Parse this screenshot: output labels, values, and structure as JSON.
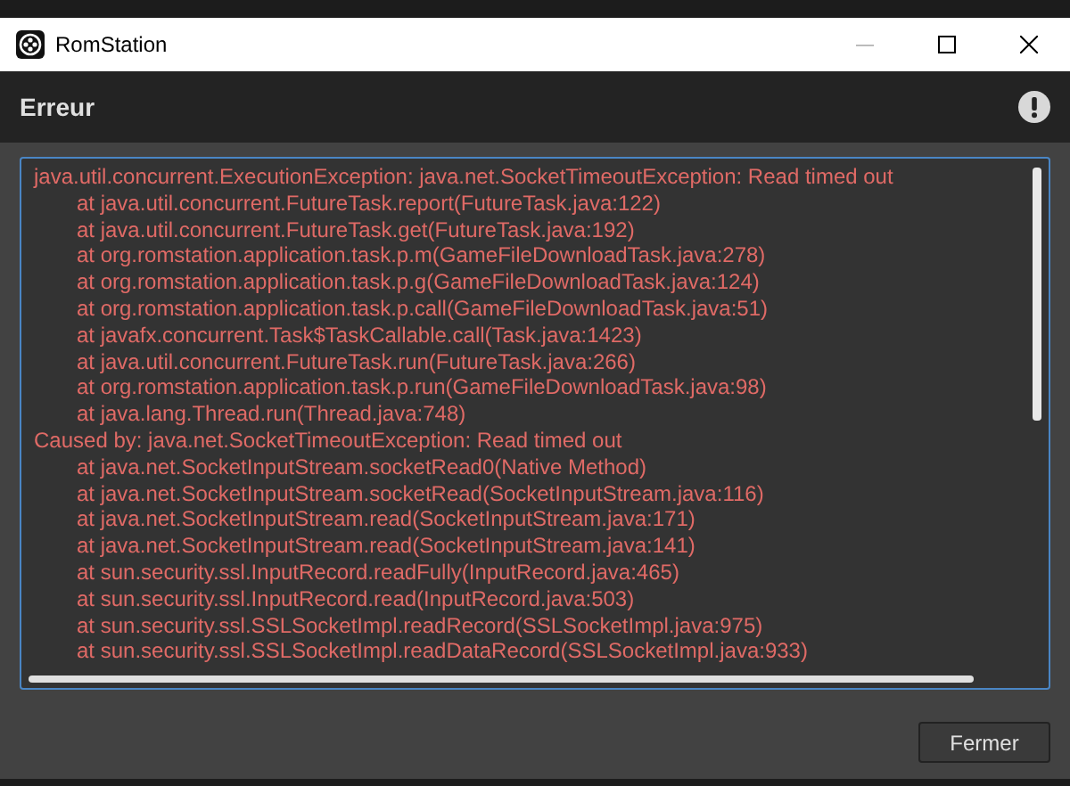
{
  "window": {
    "title": "RomStation"
  },
  "header": {
    "title": "Erreur"
  },
  "log_lines": [
    {
      "kind": "exception",
      "text": "java.util.concurrent.ExecutionException: java.net.SocketTimeoutException: Read timed out"
    },
    {
      "kind": "frame",
      "text": "at java.util.concurrent.FutureTask.report(FutureTask.java:122)"
    },
    {
      "kind": "frame",
      "text": "at java.util.concurrent.FutureTask.get(FutureTask.java:192)"
    },
    {
      "kind": "frame",
      "text": "at org.romstation.application.task.p.m(GameFileDownloadTask.java:278)"
    },
    {
      "kind": "frame",
      "text": "at org.romstation.application.task.p.g(GameFileDownloadTask.java:124)"
    },
    {
      "kind": "frame",
      "text": "at org.romstation.application.task.p.call(GameFileDownloadTask.java:51)"
    },
    {
      "kind": "frame",
      "text": "at javafx.concurrent.Task$TaskCallable.call(Task.java:1423)"
    },
    {
      "kind": "frame",
      "text": "at java.util.concurrent.FutureTask.run(FutureTask.java:266)"
    },
    {
      "kind": "frame",
      "text": "at org.romstation.application.task.p.run(GameFileDownloadTask.java:98)"
    },
    {
      "kind": "frame",
      "text": "at java.lang.Thread.run(Thread.java:748)"
    },
    {
      "kind": "exception",
      "text": "Caused by: java.net.SocketTimeoutException: Read timed out"
    },
    {
      "kind": "frame",
      "text": "at java.net.SocketInputStream.socketRead0(Native Method)"
    },
    {
      "kind": "frame",
      "text": "at java.net.SocketInputStream.socketRead(SocketInputStream.java:116)"
    },
    {
      "kind": "frame",
      "text": "at java.net.SocketInputStream.read(SocketInputStream.java:171)"
    },
    {
      "kind": "frame",
      "text": "at java.net.SocketInputStream.read(SocketInputStream.java:141)"
    },
    {
      "kind": "frame",
      "text": "at sun.security.ssl.InputRecord.readFully(InputRecord.java:465)"
    },
    {
      "kind": "frame",
      "text": "at sun.security.ssl.InputRecord.read(InputRecord.java:503)"
    },
    {
      "kind": "frame",
      "text": "at sun.security.ssl.SSLSocketImpl.readRecord(SSLSocketImpl.java:975)"
    },
    {
      "kind": "frame",
      "text": "at sun.security.ssl.SSLSocketImpl.readDataRecord(SSLSocketImpl.java:933)"
    }
  ],
  "buttons": [
    "Fermer"
  ]
}
